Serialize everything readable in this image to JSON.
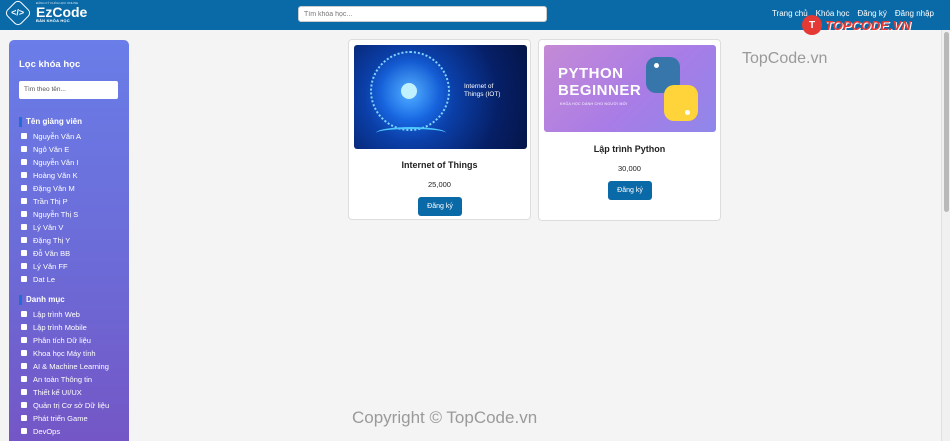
{
  "header": {
    "logo": {
      "top_text": "ĐĂNG KÝ KHÓA HỌC ONLINE",
      "name": "EzCode",
      "sub": "BÁN KHÓA HỌC",
      "mark": "</>"
    },
    "search_placeholder": "Tìm khóa học...",
    "nav": [
      "Trang chủ",
      "Khóa học",
      "Đăng ký",
      "Đăng nhập"
    ]
  },
  "sidebar": {
    "title": "Lọc khóa học",
    "filter_placeholder": "Tìm theo tên...",
    "instructors_title": "Tên giảng viên",
    "instructors": [
      "Nguyễn Văn A",
      "Ngô Văn E",
      "Nguyễn Văn I",
      "Hoàng Văn K",
      "Đặng Văn M",
      "Trần Thị P",
      "Nguyễn Thị S",
      "Lý Văn V",
      "Đặng Thị Y",
      "Đỗ Văn BB",
      "Lý Văn FF",
      "Dat Le"
    ],
    "categories_title": "Danh mục",
    "categories": [
      "Lập trình Web",
      "Lập trình Mobile",
      "Phân tích Dữ liệu",
      "Khoa học Máy tính",
      "AI & Machine Learning",
      "An toàn Thông tin",
      "Thiết kế UI/UX",
      "Quản trị Cơ sở Dữ liệu",
      "Phát triển Game",
      "DevOps"
    ]
  },
  "courses": [
    {
      "title": "Internet of Things",
      "price": "25,000",
      "button": "Đăng ký",
      "image_text": [
        "Internet of",
        "Things (IOT)"
      ]
    },
    {
      "title": "Lập trình Python",
      "price": "30,000",
      "button": "Đăng ký",
      "image_text": [
        "PYTHON",
        "BEGINNER"
      ],
      "image_sub": "KHÓA HỌC DÀNH CHO NGƯỜI MỚI"
    }
  ],
  "watermarks": {
    "brand": "TOPCODE.VN",
    "badge": "T",
    "right": "TopCode.vn",
    "bottom": "Copyright © TopCode.vn"
  },
  "colors": {
    "header": "#0a6aa8",
    "accent": "#0a6aa8",
    "sidebar_top": "#6a7de8",
    "sidebar_bottom": "#7554c4"
  }
}
